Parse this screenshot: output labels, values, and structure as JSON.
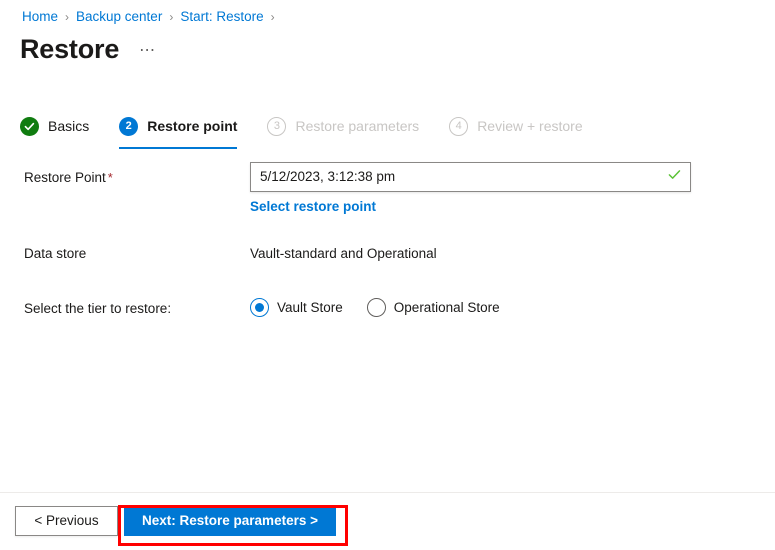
{
  "breadcrumb": {
    "separator": "›",
    "items": [
      {
        "label": "Home"
      },
      {
        "label": "Backup center"
      },
      {
        "label": "Start: Restore"
      }
    ]
  },
  "header": {
    "title": "Restore",
    "ellipsis": "⋯"
  },
  "wizard": {
    "tabs": [
      {
        "badge": "✓",
        "label": "Basics",
        "state": "done"
      },
      {
        "badge": "2",
        "label": "Restore point",
        "state": "active"
      },
      {
        "badge": "3",
        "label": "Restore parameters",
        "state": "pending"
      },
      {
        "badge": "4",
        "label": "Review + restore",
        "state": "pending"
      }
    ]
  },
  "form": {
    "restore_point": {
      "label": "Restore Point",
      "required_marker": "*",
      "value": "5/12/2023, 3:12:38 pm",
      "placeholder": "Select restore point",
      "validation_icon": "check-icon",
      "link_label": "Select restore point"
    },
    "data_store": {
      "label": "Data store",
      "value": "Vault-standard and Operational"
    },
    "tier": {
      "label": "Select the tier to restore:",
      "options": [
        {
          "label": "Vault Store",
          "checked": true
        },
        {
          "label": "Operational Store",
          "checked": false
        }
      ]
    }
  },
  "footer": {
    "previous_label": "< Previous",
    "next_label": "Next: Restore parameters >"
  },
  "colors": {
    "accent": "#0078d4",
    "success": "#107c10",
    "required": "#a4262c",
    "disabled": "#c8c6c4",
    "highlight": "#ff0000"
  }
}
